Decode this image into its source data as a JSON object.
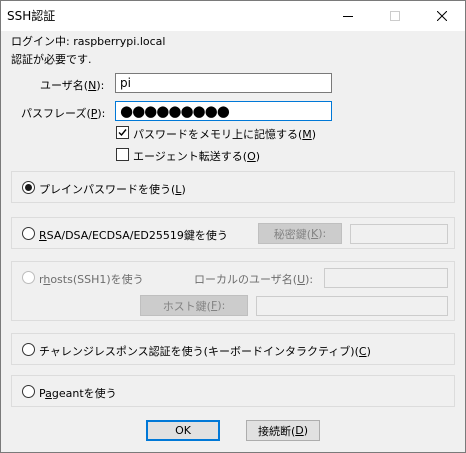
{
  "window": {
    "title": "SSH認証"
  },
  "info": {
    "login_line": "ログイン中: raspberrypi.local",
    "auth_required": "認証が必要です."
  },
  "username": {
    "label_pre": "ユーザ名(",
    "label_key": "N",
    "label_post": "):",
    "value": "pi"
  },
  "passphrase": {
    "label_pre": "パスフレーズ(",
    "label_key": "P",
    "label_post": "):",
    "masked": "●●●●●●●●●"
  },
  "options": {
    "remember_pre": "パスワードをメモリ上に記憶する(",
    "remember_key": "M",
    "remember_post": ")",
    "remember_checked": true,
    "agent_pre": "エージェント転送する(",
    "agent_key": "O",
    "agent_post": ")",
    "agent_checked": false
  },
  "methods": {
    "plain_pre": "プレインパスワードを使う(",
    "plain_key": "L",
    "plain_post": ")",
    "rsa_key_char": "R",
    "rsa_rest": "SA/DSA/ECDSA/ED25519鍵を使う",
    "private_key_pre": "秘密鍵(",
    "private_key_key": "K",
    "private_key_post": "):",
    "rhosts_pre": "r",
    "rhosts_key": "h",
    "rhosts_post": "osts(SSH1)を使う",
    "local_user_pre": "ローカルのユーザ名(",
    "local_user_key": "U",
    "local_user_post": "):",
    "host_key_pre": "ホスト鍵(",
    "host_key_key": "F",
    "host_key_post": "):",
    "challenge_pre": "チャレンジレスポンス認証を使う(キーボードインタラクティブ)(",
    "challenge_key": "C",
    "challenge_post": ")",
    "pageant_pre": "P",
    "pageant_key": "a",
    "pageant_post": "geantを使う"
  },
  "buttons": {
    "ok": "OK",
    "disconnect_pre": "接続断(",
    "disconnect_key": "D",
    "disconnect_post": ")"
  }
}
